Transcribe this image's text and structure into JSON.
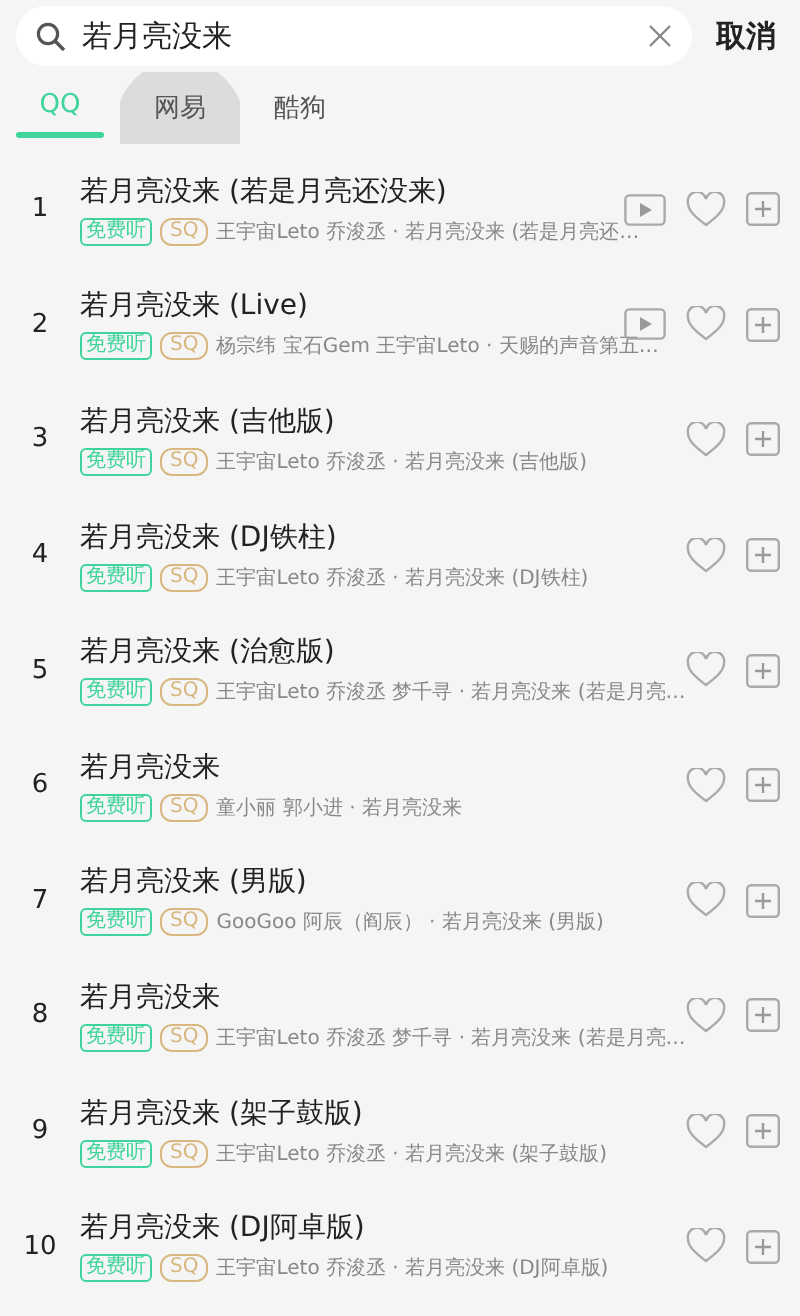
{
  "search": {
    "value": "若月亮没来",
    "cancel": "取消"
  },
  "tabs": [
    {
      "label": "QQ",
      "selected": true,
      "pressed": false
    },
    {
      "label": "网易",
      "selected": false,
      "pressed": true
    },
    {
      "label": "酷狗",
      "selected": false,
      "pressed": false
    }
  ],
  "songs": [
    {
      "index": "1",
      "title": "若月亮没来 (若是月亮还没来)",
      "free_badge": "免费听",
      "quality_badge": "SQ",
      "meta": "王宇宙Leto 乔浚丞 · 若月亮没来 (若是月亮还…",
      "has_video": true
    },
    {
      "index": "2",
      "title": "若月亮没来 (Live)",
      "free_badge": "免费听",
      "quality_badge": "SQ",
      "meta": "杨宗纬 宝石Gem 王宇宙Leto · 天赐的声音第五…",
      "has_video": true
    },
    {
      "index": "3",
      "title": "若月亮没来 (吉他版)",
      "free_badge": "免费听",
      "quality_badge": "SQ",
      "meta": "王宇宙Leto 乔浚丞 · 若月亮没来 (吉他版)",
      "has_video": false
    },
    {
      "index": "4",
      "title": "若月亮没来 (DJ铁柱)",
      "free_badge": "免费听",
      "quality_badge": "SQ",
      "meta": "王宇宙Leto 乔浚丞 · 若月亮没来 (DJ铁柱)",
      "has_video": false
    },
    {
      "index": "5",
      "title": "若月亮没来 (治愈版)",
      "free_badge": "免费听",
      "quality_badge": "SQ",
      "meta": "王宇宙Leto 乔浚丞 梦千寻 · 若月亮没来 (若是月亮…",
      "has_video": false
    },
    {
      "index": "6",
      "title": "若月亮没来",
      "free_badge": "免费听",
      "quality_badge": "SQ",
      "meta": "童小丽 郭小进 · 若月亮没来",
      "has_video": false
    },
    {
      "index": "7",
      "title": "若月亮没来 (男版)",
      "free_badge": "免费听",
      "quality_badge": "SQ",
      "meta": "GooGoo 阿辰（阎辰） · 若月亮没来 (男版)",
      "has_video": false
    },
    {
      "index": "8",
      "title": "若月亮没来",
      "free_badge": "免费听",
      "quality_badge": "SQ",
      "meta": "王宇宙Leto 乔浚丞 梦千寻 · 若月亮没来 (若是月亮…",
      "has_video": false
    },
    {
      "index": "9",
      "title": "若月亮没来 (架子鼓版)",
      "free_badge": "免费听",
      "quality_badge": "SQ",
      "meta": "王宇宙Leto 乔浚丞 · 若月亮没来 (架子鼓版)",
      "has_video": false
    },
    {
      "index": "10",
      "title": "若月亮没来 (DJ阿卓版)",
      "free_badge": "免费听",
      "quality_badge": "SQ",
      "meta": "王宇宙Leto 乔浚丞 · 若月亮没来 (DJ阿卓版)",
      "has_video": false
    }
  ]
}
